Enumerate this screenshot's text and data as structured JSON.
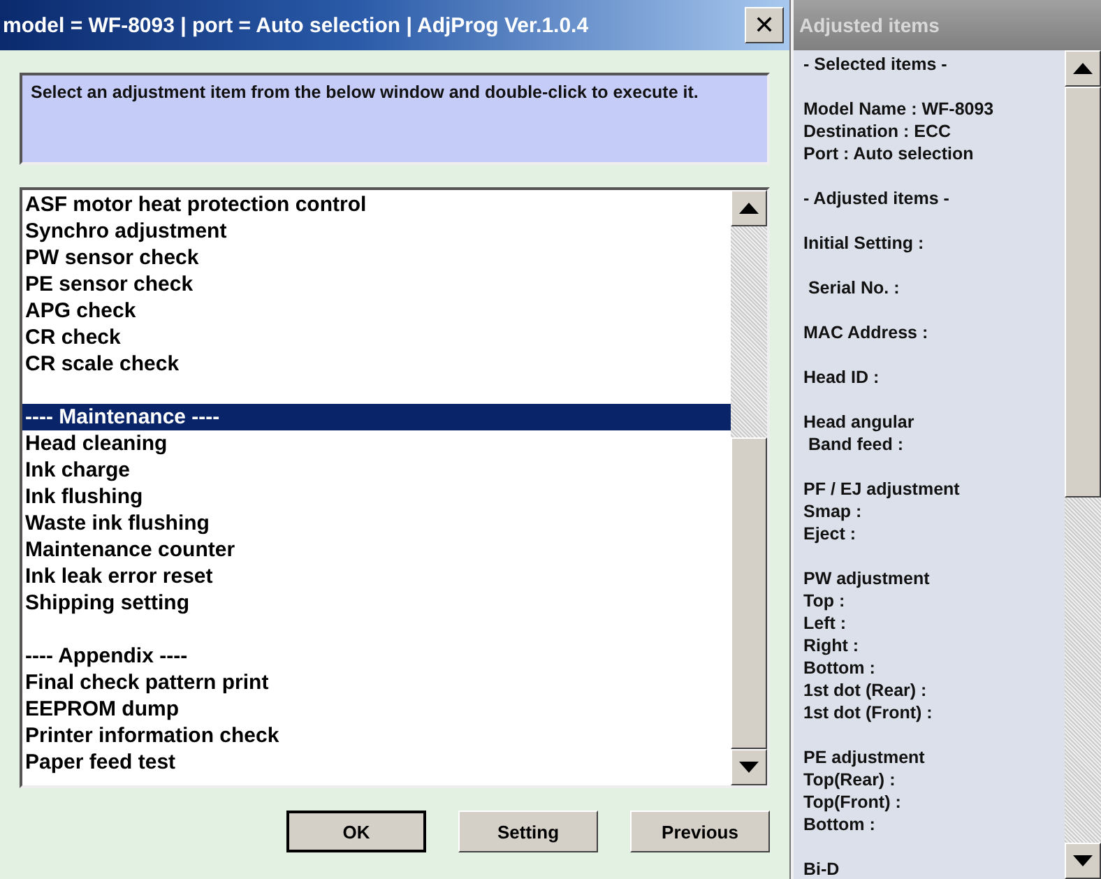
{
  "window": {
    "title": "model = WF-8093 | port = Auto selection | AdjProg Ver.1.0.4",
    "close_label": "✕"
  },
  "instruction": "Select an adjustment item from the below window and double-click to execute it.",
  "adjustment_list": {
    "groups": [
      [
        {
          "label": "ASF motor heat protection control",
          "selected": false
        },
        {
          "label": "Synchro adjustment",
          "selected": false
        },
        {
          "label": "PW sensor check",
          "selected": false
        },
        {
          "label": "PE sensor check",
          "selected": false
        },
        {
          "label": "APG check",
          "selected": false
        },
        {
          "label": "CR check",
          "selected": false
        },
        {
          "label": "CR scale check",
          "selected": false
        }
      ],
      [
        {
          "label": "---- Maintenance ----",
          "selected": true
        },
        {
          "label": "Head cleaning",
          "selected": false
        },
        {
          "label": "Ink charge",
          "selected": false
        },
        {
          "label": "Ink flushing",
          "selected": false
        },
        {
          "label": "Waste ink flushing",
          "selected": false
        },
        {
          "label": "Maintenance counter",
          "selected": false
        },
        {
          "label": "Ink leak error reset",
          "selected": false
        },
        {
          "label": "Shipping setting",
          "selected": false
        }
      ],
      [
        {
          "label": "---- Appendix ----",
          "selected": false
        },
        {
          "label": "Final check pattern print",
          "selected": false
        },
        {
          "label": "EEPROM dump",
          "selected": false
        },
        {
          "label": "Printer information check",
          "selected": false
        },
        {
          "label": "Paper feed test",
          "selected": false
        }
      ]
    ]
  },
  "buttons": [
    {
      "label": "OK",
      "default": true
    },
    {
      "label": "Setting",
      "default": false
    },
    {
      "label": "Previous",
      "default": false
    }
  ],
  "adjusted_panel": {
    "title": "Adjusted items",
    "sections": [
      [
        "- Selected items -"
      ],
      [
        "Model Name : WF-8093",
        "Destination : ECC",
        "Port : Auto selection"
      ],
      [
        "- Adjusted items -"
      ],
      [
        "Initial Setting :"
      ],
      [
        " Serial No. :"
      ],
      [
        "MAC Address :"
      ],
      [
        "Head ID :"
      ],
      [
        "Head angular",
        " Band feed :"
      ],
      [
        "PF / EJ adjustment",
        "Smap :",
        "Eject :"
      ],
      [
        "PW adjustment",
        "Top :",
        "Left :",
        "Right :",
        "Bottom :",
        "1st dot (Rear) :",
        "1st dot (Front) :"
      ],
      [
        "PE adjustment",
        "Top(Rear) :",
        "Top(Front) :",
        "Bottom :"
      ],
      [
        "Bi-D"
      ]
    ]
  }
}
